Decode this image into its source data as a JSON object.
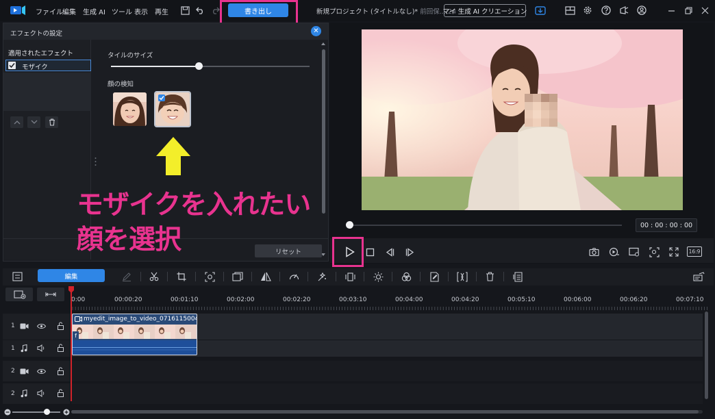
{
  "menu": {
    "items": [
      "ファイル",
      "編集",
      "生成 AI",
      "ツール",
      "表示",
      "再生"
    ],
    "export_label": "書き出し",
    "project_title": "新規プロジェクト (タイトルなし)*",
    "project_saved": "前回保...:24",
    "ai_creation_label": "マイ 生成 AI クリエーション"
  },
  "effect_panel": {
    "title": "エフェクトの設定",
    "applied_title": "適用されたエフェクト",
    "applied_item": "モザイク",
    "tile_size_label": "タイルのサイズ",
    "tile_size_value": 0.44,
    "face_detect_label": "顔の検知",
    "reset_label": "リセット"
  },
  "annotation": {
    "line1": "モザイクを入れたい",
    "line2": "顔を選択"
  },
  "preview": {
    "timecode": "00 : 00 : 00 : 00",
    "aspect_label": "16:9"
  },
  "timeline": {
    "edit_tab": "編集",
    "ruler_labels": [
      "0:00",
      "00:00:20",
      "00:01:10",
      "00:02:00",
      "00:02:20",
      "00:03:10",
      "00:04:00",
      "00:04:20",
      "00:05:10",
      "00:06:00",
      "00:06:20",
      "00:07:10"
    ],
    "tracks": [
      {
        "num": "1",
        "kind": "video"
      },
      {
        "num": "1",
        "kind": "audio"
      },
      {
        "num": "2",
        "kind": "video"
      },
      {
        "num": "2",
        "kind": "audio"
      }
    ],
    "clip_title": "myedit_image_to_video_0716115004"
  },
  "colors": {
    "accent": "#2f86e6",
    "annotation": "#e8338f",
    "arrow": "#f3ee2a",
    "playhead": "#d2232a"
  }
}
